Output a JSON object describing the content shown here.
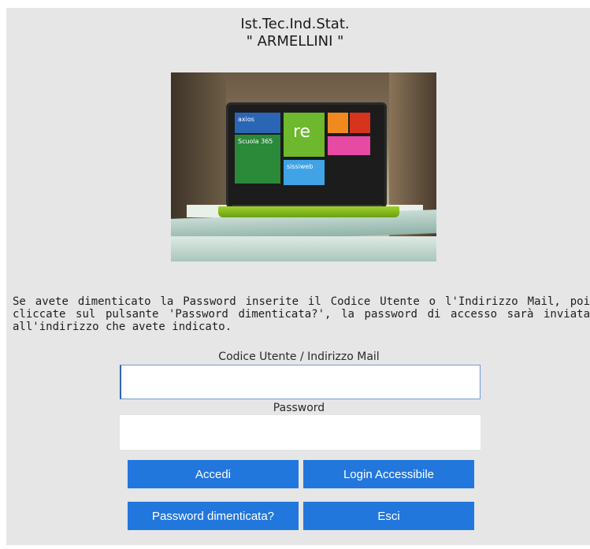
{
  "header": {
    "line1": "Ist.Tec.Ind.Stat.",
    "line2": "\" ARMELLINI \""
  },
  "hero": {
    "tiles": [
      "axios",
      "Scuola 365",
      "re",
      "",
      "",
      "",
      "sissiweb"
    ]
  },
  "info_text": "Se avete dimenticato la Password inserite il Codice Utente o l'Indirizzo Mail, poi cliccate sul pulsante 'Password dimenticata?', la password di accesso sarà inviata all'indirizzo che avete indicato.",
  "form": {
    "user_label": "Codice Utente / Indirizzo Mail",
    "user_value": "",
    "password_label": "Password",
    "password_value": ""
  },
  "buttons": {
    "accedi": "Accedi",
    "login_accessibile": "Login Accessibile",
    "password_dimenticata": "Password dimenticata?",
    "esci": "Esci"
  },
  "colors": {
    "button_bg": "#2277dd",
    "panel_bg": "#e6e6e6"
  }
}
